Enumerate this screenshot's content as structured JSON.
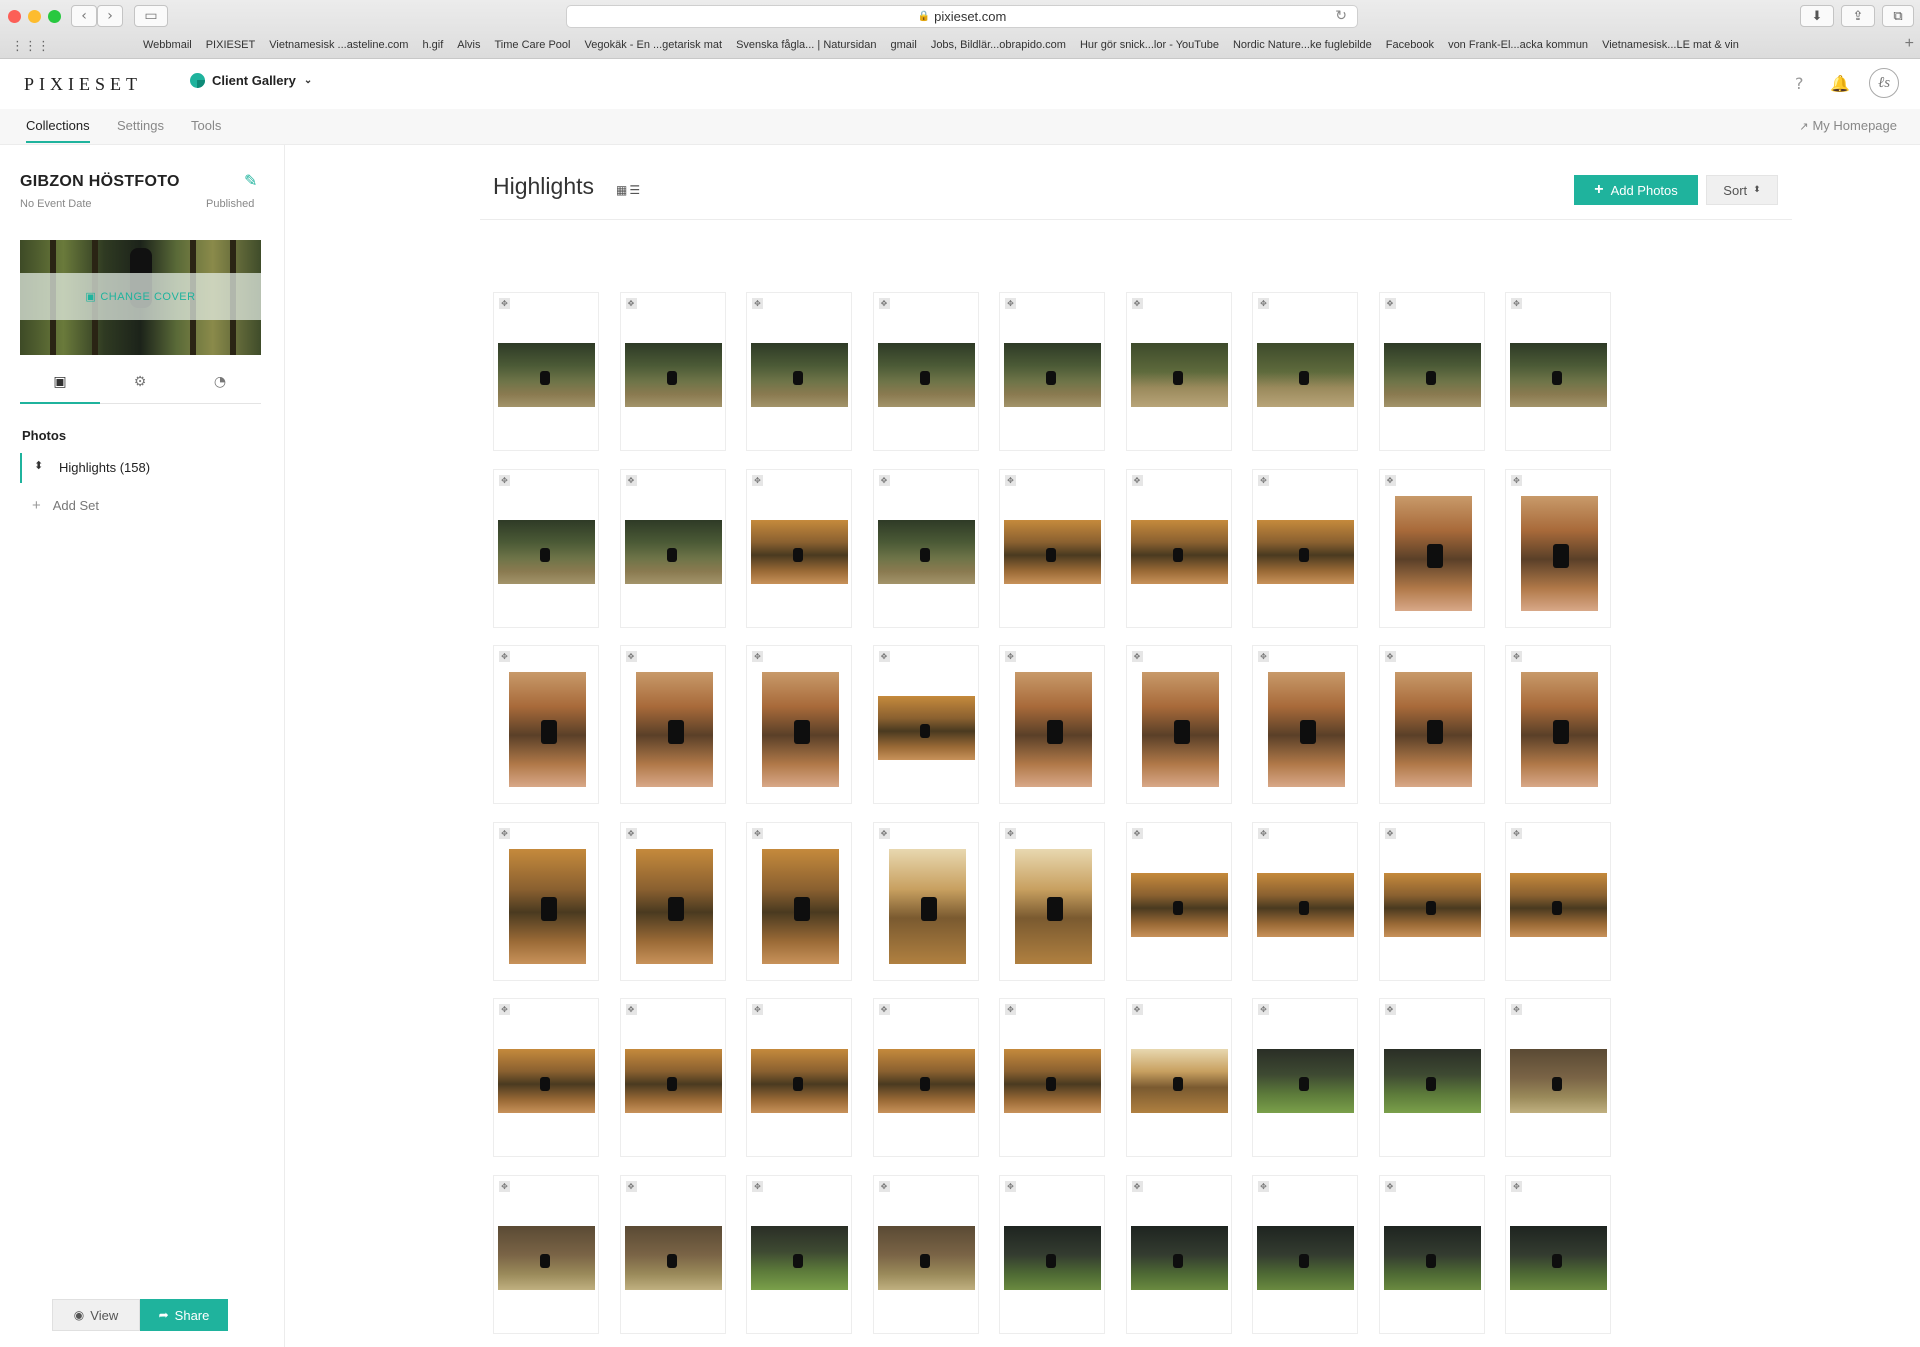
{
  "browser": {
    "url": "pixieset.com",
    "bookmarks": [
      "Webbmail",
      "PIXIESET",
      "Vietnamesisk ...asteline.com",
      "h.gif",
      "Alvis",
      "Time Care Pool",
      "Vegokäk - En ...getarisk mat",
      "Svenska fågla... | Natursidan",
      "gmail",
      "Jobs, Bildlär...obrapido.com",
      "Hur gör snick...lor - YouTube",
      "Nordic Nature...ke fuglebilde",
      "Facebook",
      "von Frank-El...acka kommun",
      "Vietnamesisk...LE mat & vin"
    ]
  },
  "header": {
    "logo": "PIXIESET",
    "app_switcher": "Client Gallery",
    "icons": [
      "help-icon",
      "bell-icon",
      "avatar"
    ]
  },
  "subnav": {
    "tabs": [
      "Collections",
      "Settings",
      "Tools"
    ],
    "active_tab": "Collections",
    "homepage_link": "My Homepage"
  },
  "sidebar": {
    "collection_title": "GIBZON HÖSTFOTO",
    "event_date": "No Event Date",
    "status": "Published",
    "change_cover": "CHANGE COVER",
    "section_tabs": [
      "photos-icon",
      "gear-icon",
      "rss-icon"
    ],
    "photos_heading": "Photos",
    "sets": [
      {
        "label": "Highlights (158)"
      }
    ],
    "add_set": "Add Set",
    "view_label": "View",
    "share_label": "Share"
  },
  "main": {
    "title": "Highlights",
    "add_photos_label": "Add Photos",
    "sort_label": "Sort",
    "accent": "#1fb39d",
    "thumbnails": [
      [
        "forest-land",
        "forest-land",
        "forest-land",
        "forest-land",
        "forest-land",
        "forestpath-land",
        "forestpath-land",
        "forest-land",
        "forest-land"
      ],
      [
        "forest-land",
        "forest-land",
        "autumn-land",
        "forest-land",
        "autumn-land",
        "autumn-land",
        "autumn-land",
        "autumnp-port",
        "autumnp-port"
      ],
      [
        "autumnp-port",
        "autumnp-port",
        "autumnp-port",
        "autumn-land",
        "autumnp-port",
        "autumnp-port",
        "autumnp-port",
        "autumnp-port",
        "autumnp-port"
      ],
      [
        "autumn-port",
        "autumn-port",
        "autumn-port",
        "bright-port",
        "bright-port",
        "autumn-land",
        "autumn-land",
        "autumn-land",
        "autumn-land"
      ],
      [
        "autumn-land",
        "autumn-land",
        "autumn-land",
        "autumn-land",
        "autumn-land",
        "bright-land",
        "moss-land",
        "moss-land",
        "woodbrown-land"
      ],
      [
        "woodbrown-land",
        "woodbrown-land",
        "moss-land",
        "woodbrown-land",
        "mossdark-land",
        "mossdark-land",
        "mossdark-land",
        "mossdark-land",
        "mossdark-land"
      ]
    ]
  }
}
